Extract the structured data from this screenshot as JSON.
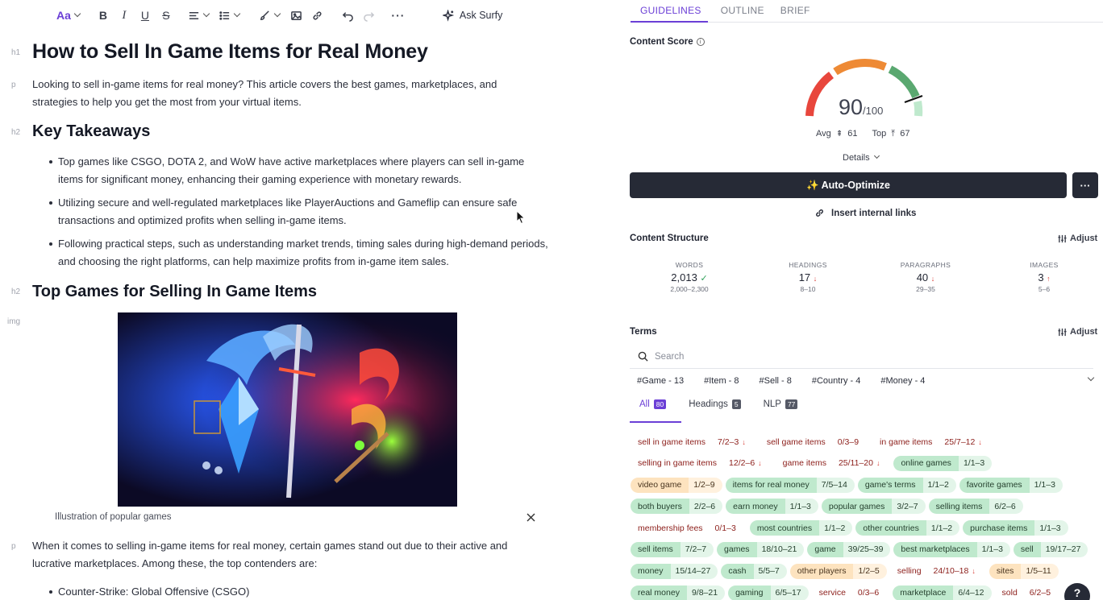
{
  "toolbar": {
    "font_label": "Aa",
    "bold": "B",
    "italic": "I",
    "underline": "U",
    "strike": "S",
    "more": "···",
    "ask_label": "Ask Surfy"
  },
  "doc": {
    "tags": {
      "h1": "h1",
      "p": "p",
      "h2": "h2",
      "img": "img"
    },
    "title": "How to Sell In Game Items for Real Money",
    "intro": "Looking to sell in-game items for real money? This article covers the best games, marketplaces, and strategies to help you get the most from your virtual items.",
    "h_takeaways": "Key Takeaways",
    "takeaways": [
      "Top games like CSGO, DOTA 2, and WoW have active marketplaces where players can sell in-game items for significant money, enhancing their gaming experience with monetary rewards.",
      "Utilizing secure and well-regulated marketplaces like PlayerAuctions and Gameflip can ensure safe transactions and optimized profits when selling in-game items.",
      "Following practical steps, such as understanding market trends, timing sales during high-demand periods, and choosing the right platforms, can help maximize profits from in-game item sales."
    ],
    "h_top_games": "Top Games for Selling In Game Items",
    "image_caption": "Illustration of popular games",
    "para2": "When it comes to selling in-game items for real money, certain games stand out due to their active and lucrative marketplaces. Among these, the top contenders are:",
    "list2_first": "Counter-Strike: Global Offensive (CSGO)"
  },
  "panel": {
    "tabs": [
      "GUIDELINES",
      "OUTLINE",
      "BRIEF"
    ],
    "content_score_label": "Content Score",
    "info_glyph": "i",
    "score": "90",
    "score_max": "/100",
    "avg_label": "Avg",
    "avg_value": "61",
    "top_label": "Top",
    "top_value": "67",
    "details_label": "Details",
    "auto_optimize": "✨ Auto-Optimize",
    "more_glyph": "···",
    "internal_links": "Insert internal links",
    "structure_title": "Content Structure",
    "adjust": "Adjust",
    "metrics": [
      {
        "label": "WORDS",
        "value": "2,013",
        "status": "✓",
        "range": "2,000–2,300"
      },
      {
        "label": "HEADINGS",
        "value": "17",
        "status": "↓",
        "range": "8–10"
      },
      {
        "label": "PARAGRAPHS",
        "value": "40",
        "status": "↓",
        "range": "29–35"
      },
      {
        "label": "IMAGES",
        "value": "3",
        "status": "↑",
        "range": "5–6"
      }
    ],
    "terms_title": "Terms",
    "search_placeholder": "Search",
    "hashtags": [
      "#Game - 13",
      "#Item - 8",
      "#Sell - 8",
      "#Country - 4",
      "#Money - 4"
    ],
    "term_tabs": [
      {
        "label": "All",
        "count": "80"
      },
      {
        "label": "Headings",
        "count": "5"
      },
      {
        "label": "NLP",
        "count": "77"
      }
    ],
    "term_rows": [
      [
        {
          "name": "sell in game items",
          "count": "7/2–3",
          "status": "red",
          "arrow": "↓"
        },
        {
          "name": "sell game items",
          "count": "0/3–9",
          "status": "red",
          "arrow": ""
        },
        {
          "name": "in game items",
          "count": "25/7–12",
          "status": "red",
          "arrow": "↓"
        }
      ],
      [
        {
          "name": "selling in game items",
          "count": "12/2–6",
          "status": "red",
          "arrow": "↓"
        },
        {
          "name": "game items",
          "count": "25/11–20",
          "status": "red",
          "arrow": "↓"
        },
        {
          "name": "online games",
          "count": "1/1–3",
          "status": "green",
          "arrow": ""
        }
      ],
      [
        {
          "name": "video game",
          "count": "1/2–9",
          "status": "orange",
          "arrow": ""
        },
        {
          "name": "items for real money",
          "count": "7/5–14",
          "status": "green",
          "arrow": ""
        },
        {
          "name": "game's terms",
          "count": "1/1–2",
          "status": "green",
          "arrow": ""
        },
        {
          "name": "favorite games",
          "count": "1/1–3",
          "status": "green",
          "arrow": ""
        }
      ],
      [
        {
          "name": "both buyers",
          "count": "2/2–6",
          "status": "green",
          "arrow": ""
        },
        {
          "name": "earn money",
          "count": "1/1–3",
          "status": "green",
          "arrow": ""
        },
        {
          "name": "popular games",
          "count": "3/2–7",
          "status": "green",
          "arrow": ""
        },
        {
          "name": "selling items",
          "count": "6/2–6",
          "status": "green",
          "arrow": ""
        }
      ],
      [
        {
          "name": "membership fees",
          "count": "0/1–3",
          "status": "red",
          "arrow": ""
        },
        {
          "name": "most countries",
          "count": "1/1–2",
          "status": "green",
          "arrow": ""
        },
        {
          "name": "other countries",
          "count": "1/1–2",
          "status": "green",
          "arrow": ""
        },
        {
          "name": "purchase items",
          "count": "1/1–3",
          "status": "green",
          "arrow": ""
        }
      ],
      [
        {
          "name": "sell items",
          "count": "7/2–7",
          "status": "green",
          "arrow": ""
        },
        {
          "name": "games",
          "count": "18/10–21",
          "status": "green",
          "arrow": ""
        },
        {
          "name": "game",
          "count": "39/25–39",
          "status": "green",
          "arrow": ""
        },
        {
          "name": "best marketplaces",
          "count": "1/1–3",
          "status": "green",
          "arrow": ""
        },
        {
          "name": "sell",
          "count": "19/17–27",
          "status": "green",
          "arrow": ""
        }
      ],
      [
        {
          "name": "money",
          "count": "15/14–27",
          "status": "green",
          "arrow": ""
        },
        {
          "name": "cash",
          "count": "5/5–7",
          "status": "green",
          "arrow": ""
        },
        {
          "name": "other players",
          "count": "1/2–5",
          "status": "orange",
          "arrow": ""
        },
        {
          "name": "selling",
          "count": "24/10–18",
          "status": "red",
          "arrow": "↓"
        },
        {
          "name": "sites",
          "count": "1/5–11",
          "status": "orange",
          "arrow": ""
        }
      ],
      [
        {
          "name": "real money",
          "count": "9/8–21",
          "status": "green",
          "arrow": ""
        },
        {
          "name": "gaming",
          "count": "6/5–17",
          "status": "green",
          "arrow": ""
        },
        {
          "name": "service",
          "count": "0/3–6",
          "status": "red",
          "arrow": ""
        },
        {
          "name": "marketplace",
          "count": "6/4–12",
          "status": "green",
          "arrow": ""
        },
        {
          "name": "sold",
          "count": "6/2–5",
          "status": "red",
          "arrow": ""
        }
      ]
    ],
    "help_glyph": "?"
  }
}
